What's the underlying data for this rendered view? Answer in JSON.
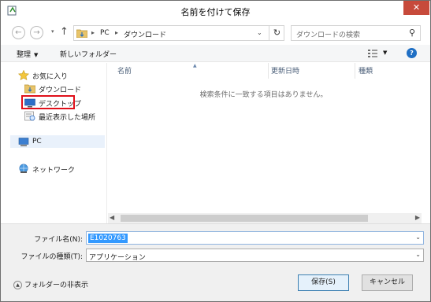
{
  "window": {
    "title": "名前を付けて保存",
    "close_glyph": "✕"
  },
  "address_bar": {
    "crumbs": [
      "PC",
      "ダウンロード"
    ],
    "separator": "▸"
  },
  "search": {
    "placeholder": "ダウンロードの検索"
  },
  "toolbar": {
    "organize_label": "整理",
    "new_folder_label": "新しいフォルダー"
  },
  "nav_pane": {
    "items": [
      {
        "label": "お気に入り",
        "icon": "star-icon"
      },
      {
        "label": "ダウンロード",
        "icon": "downloads-folder-icon"
      },
      {
        "label": "デスクトップ",
        "icon": "desktop-icon"
      },
      {
        "label": "最近表示した場所",
        "icon": "recent-places-icon"
      },
      {
        "label": "PC",
        "icon": "computer-icon"
      },
      {
        "label": "ネットワーク",
        "icon": "network-icon"
      }
    ]
  },
  "file_list": {
    "columns": [
      "名前",
      "更新日時",
      "種類"
    ],
    "empty_message": "検索条件に一致する項目はありません。"
  },
  "bottom_panel": {
    "filename_label": "ファイル名(N):",
    "filename_value": "E1020763",
    "filetype_label": "ファイルの種類(T):",
    "filetype_value": "アプリケーション",
    "hide_folders_label": "フォルダーの非表示",
    "save_label": "保存(S)",
    "cancel_label": "キャンセル"
  },
  "colors": {
    "close_button": "#c74a3b",
    "selection": "#3399ff",
    "highlight_box": "#e0101a",
    "help_icon": "#1f6fc4"
  }
}
